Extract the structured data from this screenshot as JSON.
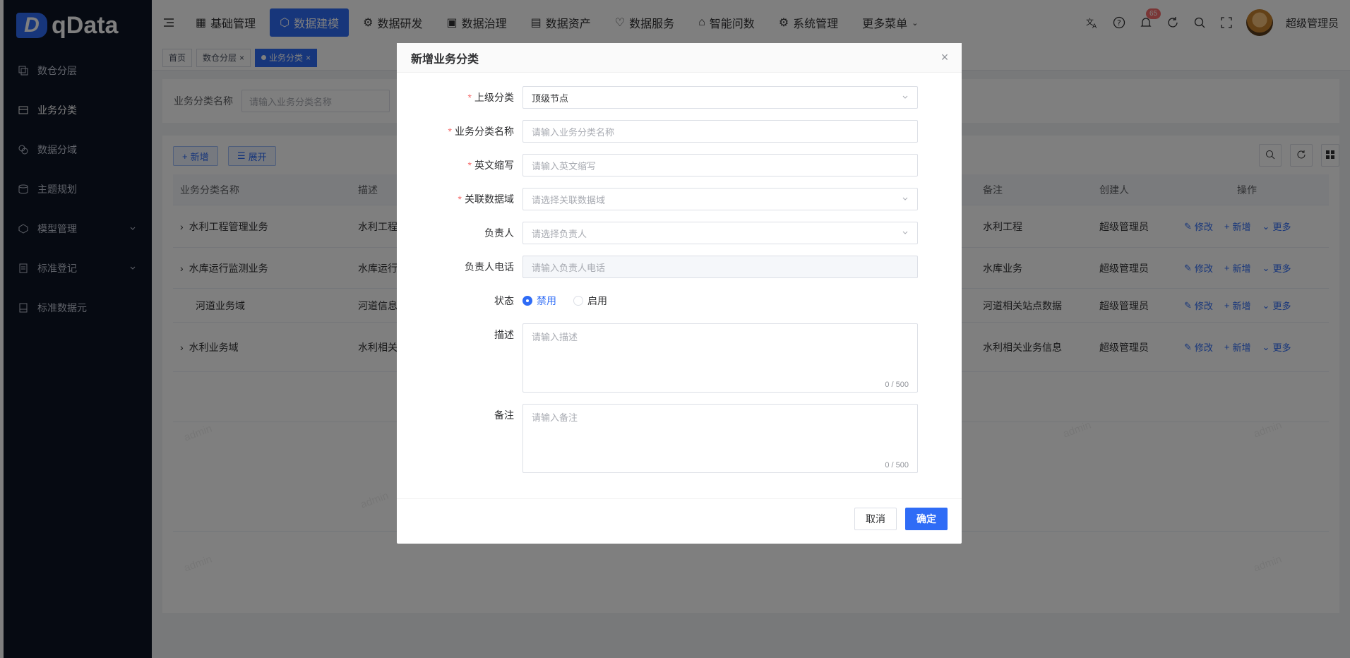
{
  "app": {
    "logo_letter": "D",
    "logo_name": "qData"
  },
  "sidebar": {
    "items": [
      {
        "label": "数仓分层",
        "icon": "layers-icon"
      },
      {
        "label": "业务分类",
        "icon": "category-icon",
        "active": true
      },
      {
        "label": "数据分域",
        "icon": "domain-icon"
      },
      {
        "label": "主题规划",
        "icon": "topic-icon"
      },
      {
        "label": "模型管理",
        "icon": "model-icon",
        "expandable": true
      },
      {
        "label": "标准登记",
        "icon": "register-icon",
        "expandable": true
      },
      {
        "label": "标准数据元",
        "icon": "element-icon"
      }
    ]
  },
  "topnav": {
    "items": [
      {
        "label": "基础管理"
      },
      {
        "label": "数据建模",
        "active": true
      },
      {
        "label": "数据研发"
      },
      {
        "label": "数据治理"
      },
      {
        "label": "数据资产"
      },
      {
        "label": "数据服务"
      },
      {
        "label": "智能问数"
      },
      {
        "label": "系统管理"
      },
      {
        "label": "更多菜单"
      }
    ],
    "notification_count": "65",
    "user_name": "超级管理员"
  },
  "tags": [
    {
      "label": "首页"
    },
    {
      "label": "数仓分层"
    },
    {
      "label": "业务分类",
      "active": true
    }
  ],
  "search": {
    "label": "业务分类名称",
    "placeholder": "请输入业务分类名称"
  },
  "toolbar": {
    "add_label": "新增",
    "expand_label": "展开"
  },
  "table": {
    "headers": {
      "name": "业务分类名称",
      "desc": "描述",
      "remark": "备注",
      "creator": "创建人",
      "ops": "操作"
    },
    "rows": [
      {
        "name": "水利工程管理业务",
        "desc": "水利工程",
        "remark": "水利工程",
        "creator": "超级管理员",
        "expandable": true
      },
      {
        "name": "水库运行监测业务",
        "desc": "水库运行",
        "remark": "水库业务",
        "creator": "超级管理员",
        "expandable": true
      },
      {
        "name": "河道业务域",
        "desc": "河道信息",
        "remark": "河道相关站点数据",
        "creator": "超级管理员",
        "expandable": false
      },
      {
        "name": "水利业务域",
        "desc": "水利相关",
        "remark": "水利相关业务信息",
        "creator": "超级管理员",
        "expandable": true
      }
    ],
    "ops": {
      "edit": "修改",
      "add": "新增",
      "more": "更多"
    }
  },
  "watermark": "admin",
  "dialog": {
    "title": "新增业务分类",
    "fields": {
      "parent": {
        "label": "上级分类",
        "value": "顶级节点"
      },
      "name": {
        "label": "业务分类名称",
        "placeholder": "请输入业务分类名称"
      },
      "abbr": {
        "label": "英文缩写",
        "placeholder": "请输入英文缩写"
      },
      "domain": {
        "label": "关联数据域",
        "placeholder": "请选择关联数据域"
      },
      "owner": {
        "label": "负责人",
        "placeholder": "请选择负责人"
      },
      "phone": {
        "label": "负责人电话",
        "placeholder": "请输入负责人电话"
      },
      "status": {
        "label": "状态",
        "options": [
          "禁用",
          "启用"
        ],
        "selected": "禁用"
      },
      "desc": {
        "label": "描述",
        "placeholder": "请输入描述",
        "counter": "0 / 500"
      },
      "remark": {
        "label": "备注",
        "placeholder": "请输入备注",
        "counter": "0 / 500"
      }
    },
    "cancel_label": "取消",
    "ok_label": "确定"
  },
  "colors": {
    "primary": "#2f6cf6",
    "sidebar_bg": "#0d1525",
    "required": "#f56c6c"
  }
}
